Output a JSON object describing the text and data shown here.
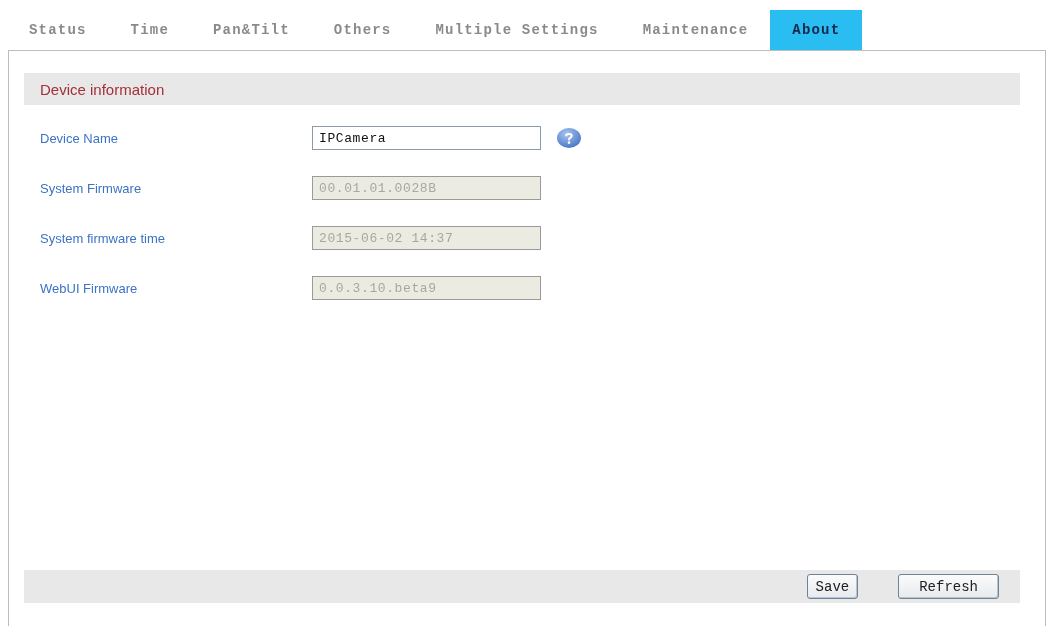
{
  "tabs": [
    {
      "label": "Status",
      "selected": false
    },
    {
      "label": "Time",
      "selected": false
    },
    {
      "label": "Pan&Tilt",
      "selected": false
    },
    {
      "label": "Others",
      "selected": false
    },
    {
      "label": "Multiple Settings",
      "selected": false
    },
    {
      "label": "Maintenance",
      "selected": false
    },
    {
      "label": "About",
      "selected": true
    }
  ],
  "section": {
    "title": "Device information",
    "fields": [
      {
        "label": "Device Name",
        "value": "IPCamera",
        "disabled": false,
        "help": true
      },
      {
        "label": "System Firmware",
        "value": "00.01.01.0028B",
        "disabled": true,
        "help": false
      },
      {
        "label": "System firmware time",
        "value": "2015-06-02 14:37",
        "disabled": true,
        "help": false
      },
      {
        "label": "WebUI Firmware",
        "value": "0.0.3.10.beta9",
        "disabled": true,
        "help": false
      }
    ]
  },
  "buttons": [
    "Save",
    "Refresh"
  ]
}
